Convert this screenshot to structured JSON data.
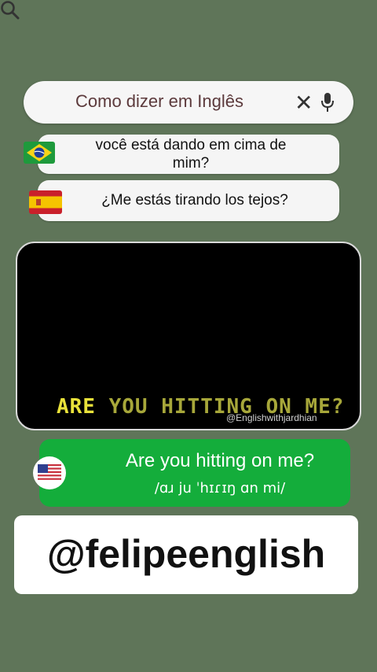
{
  "search": {
    "query": "Como dizer em Inglês",
    "icons": [
      "search-icon",
      "close-icon",
      "mic-icon"
    ]
  },
  "translations": [
    {
      "flag": "brazil-flag-icon",
      "text": "você está dando em cima de mim?"
    },
    {
      "flag": "spain-flag-icon",
      "text": "¿Me estás tirando los tejos?"
    }
  ],
  "video": {
    "caption_first": "ARE",
    "caption_rest": "YOU HITTING ON ME?",
    "watermark": "@Englishwithjardhian"
  },
  "answer": {
    "flag": "us-flag-icon",
    "text": "Are you hitting on me?",
    "ipa": "/ɑɹ ju ˈhɪɾɪŋ ɑn mi/"
  },
  "handle": "@felipeenglish",
  "colors": {
    "background": "#5f7559",
    "answer_green": "#14ad3b",
    "caption_yellow": "#e9e23a"
  }
}
